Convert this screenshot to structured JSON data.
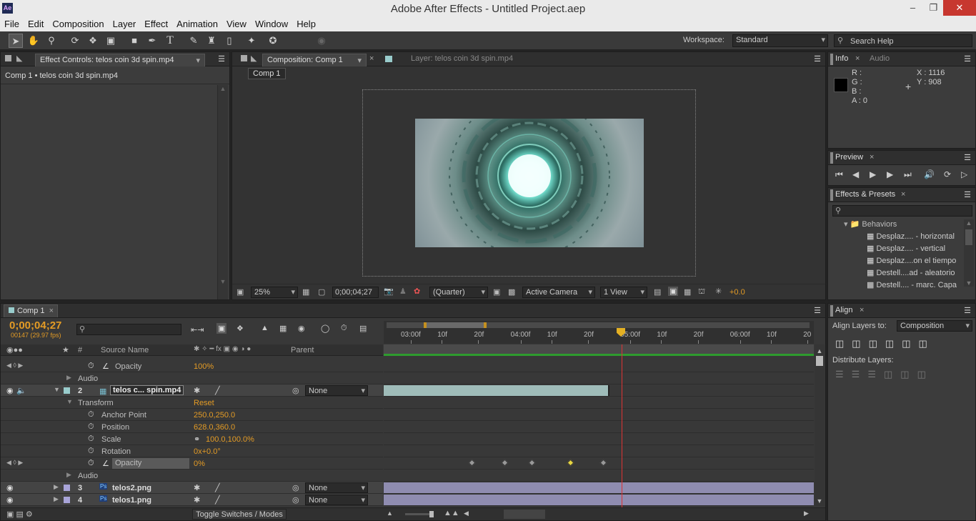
{
  "window": {
    "title": "Adobe After Effects - Untitled Project.aep",
    "app_icon": "Ae"
  },
  "menu": [
    "File",
    "Edit",
    "Composition",
    "Layer",
    "Effect",
    "Animation",
    "View",
    "Window",
    "Help"
  ],
  "toolbar": {
    "workspace_label": "Workspace:",
    "workspace_value": "Standard",
    "search_placeholder": "Search Help"
  },
  "effect_controls": {
    "tab": "Effect Controls: telos coin 3d spin.mp4",
    "breadcrumb": "Comp 1 • telos coin 3d spin.mp4"
  },
  "composition": {
    "tab": "Composition: Comp 1",
    "layer_tab": "Layer: telos coin 3d spin.mp4",
    "subtab": "Comp 1",
    "zoom": "25%",
    "timecode": "0;00;04;27",
    "resolution": "(Quarter)",
    "camera": "Active Camera",
    "view": "1 View",
    "exposure": "+0.0"
  },
  "info": {
    "tab": "Info",
    "tab2": "Audio",
    "r": "R :",
    "g": "G :",
    "b": "B :",
    "a": "A : 0",
    "x": "X : 1116",
    "y": "Y : 908"
  },
  "preview": {
    "tab": "Preview"
  },
  "effects_presets": {
    "tab": "Effects & Presets",
    "folder": "Behaviors",
    "items": [
      "Desplaz.... - horizontal",
      "Desplaz.... - vertical",
      "Desplaz....on el tiempo",
      "Destell....ad - aleatorio",
      "Destell.... - marc. Capa"
    ]
  },
  "align": {
    "tab": "Align",
    "align_to_label": "Align Layers to:",
    "align_to_value": "Composition",
    "distribute_label": "Distribute Layers:"
  },
  "timeline": {
    "tab": "Comp 1",
    "timecode": "0;00;04;27",
    "frames": "00147 (29.97 fps)",
    "col_source": "Source Name",
    "col_parent": "Parent",
    "col_num": "#",
    "ruler": [
      "03:00f",
      "10f",
      "20f",
      "04:00f",
      "10f",
      "20f",
      "05:00f",
      "10f",
      "20f",
      "06:00f",
      "10f",
      "20"
    ],
    "toggle": "Toggle Switches / Modes",
    "rows": [
      {
        "label": "Opacity",
        "value": "100%"
      },
      {
        "label": "Audio",
        "value": ""
      },
      {
        "num": "2",
        "name": "telos c... spin.mp4",
        "parent": "None"
      },
      {
        "label": "Transform",
        "value": "Reset"
      },
      {
        "label": "Anchor Point",
        "value": "250.0,250.0"
      },
      {
        "label": "Position",
        "value": "628.0,360.0"
      },
      {
        "label": "Scale",
        "value": "100.0,100.0%"
      },
      {
        "label": "Rotation",
        "value": "0x+0.0°"
      },
      {
        "label": "Opacity",
        "value": "0%"
      },
      {
        "label": "Audio",
        "value": ""
      },
      {
        "num": "3",
        "name": "telos2.png",
        "parent": "None"
      },
      {
        "num": "4",
        "name": "telos1.png",
        "parent": "None"
      }
    ],
    "keyframes_sec": [
      3.65,
      3.95,
      4.2,
      4.55,
      4.85
    ]
  }
}
